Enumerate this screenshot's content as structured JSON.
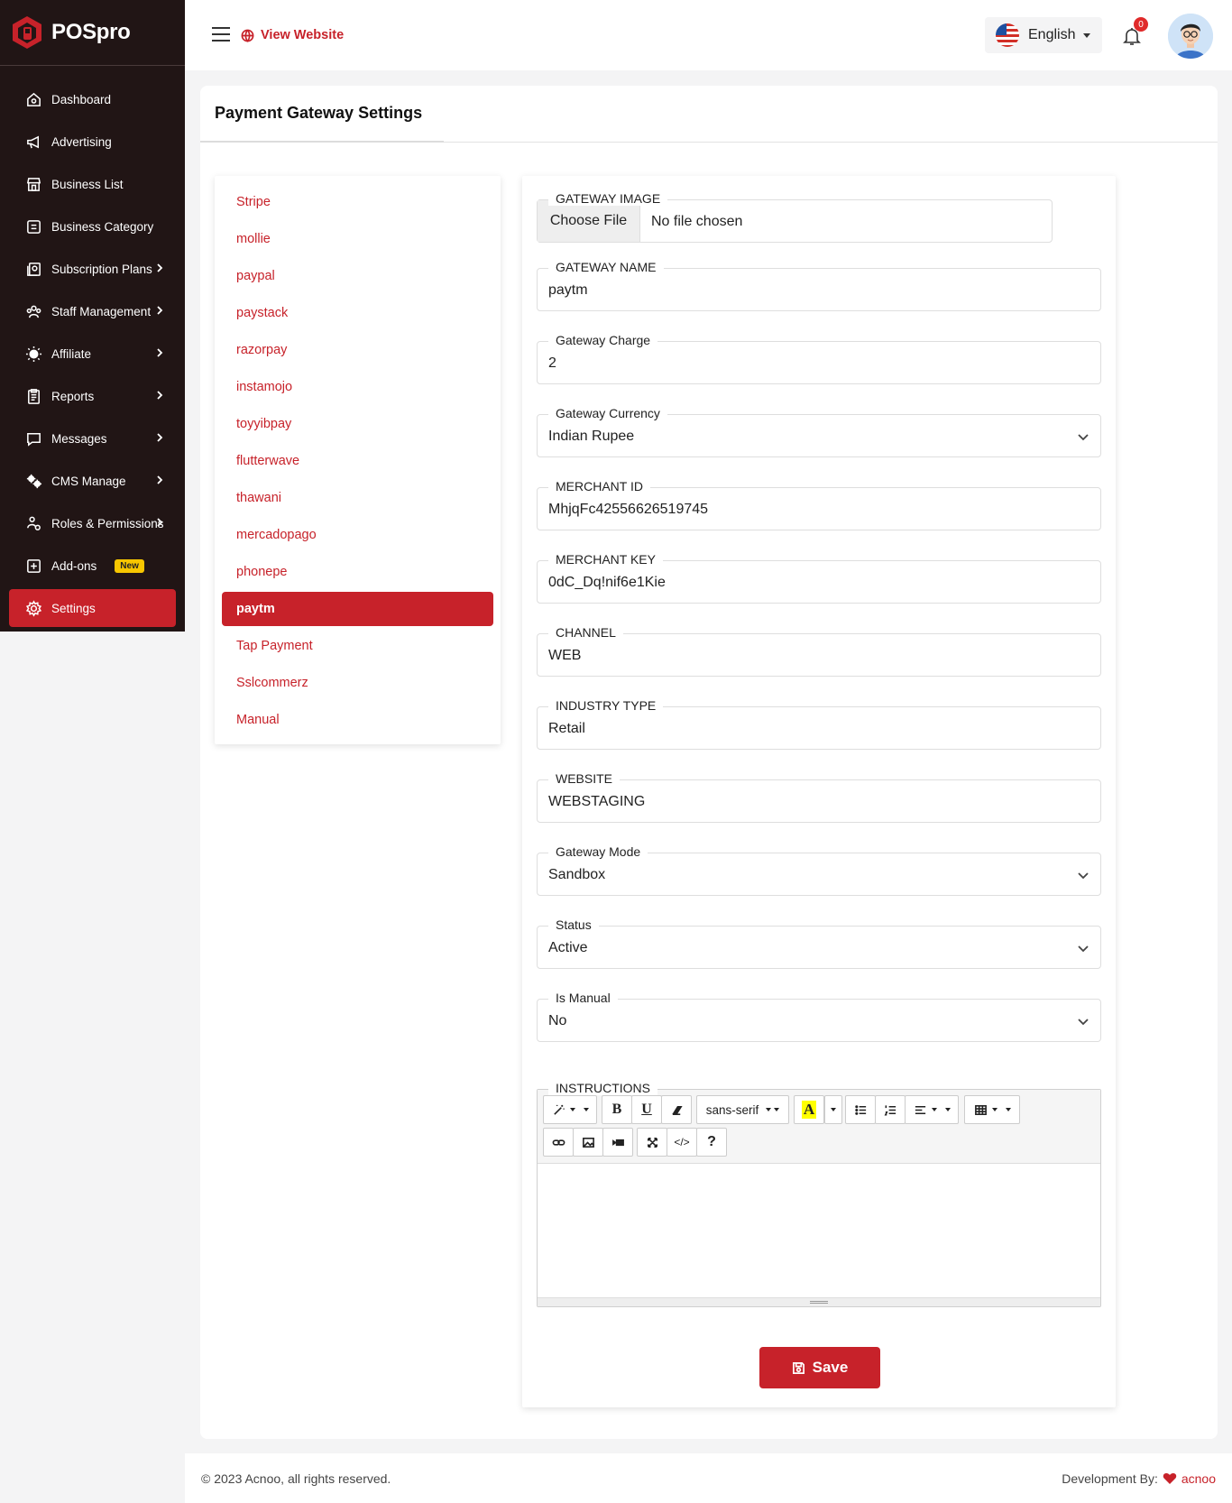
{
  "brand": {
    "name": "POSpro"
  },
  "sidebar": {
    "items": [
      {
        "label": "Dashboard",
        "icon": "home-icon",
        "chevron": false
      },
      {
        "label": "Advertising",
        "icon": "megaphone-icon",
        "chevron": false
      },
      {
        "label": "Business List",
        "icon": "store-icon",
        "chevron": false
      },
      {
        "label": "Business Category",
        "icon": "category-icon",
        "chevron": false
      },
      {
        "label": "Subscription Plans",
        "icon": "subscription-icon",
        "chevron": true
      },
      {
        "label": "Staff Management",
        "icon": "staff-icon",
        "chevron": true
      },
      {
        "label": "Affiliate",
        "icon": "affiliate-icon",
        "chevron": true
      },
      {
        "label": "Reports",
        "icon": "report-icon",
        "chevron": true
      },
      {
        "label": "Messages",
        "icon": "message-icon",
        "chevron": true
      },
      {
        "label": "CMS Manage",
        "icon": "cms-icon",
        "chevron": true
      },
      {
        "label": "Roles & Permissions",
        "icon": "roles-icon",
        "chevron": true
      },
      {
        "label": "Add-ons",
        "icon": "addon-icon",
        "chevron": false,
        "badge": "New"
      },
      {
        "label": "Settings",
        "icon": "gear-icon",
        "chevron": false,
        "active": true
      }
    ]
  },
  "header": {
    "view_website": "View Website",
    "language": "English",
    "notification_count": "0"
  },
  "page": {
    "title": "Payment Gateway Settings"
  },
  "gateways": [
    "Stripe",
    "mollie",
    "paypal",
    "paystack",
    "razorpay",
    "instamojo",
    "toyyibpay",
    "flutterwave",
    "thawani",
    "mercadopago",
    "phonepe",
    "paytm",
    "Tap Payment",
    "Sslcommerz",
    "Manual"
  ],
  "active_gateway": "paytm",
  "form": {
    "gateway_image": {
      "label": "GATEWAY IMAGE",
      "button": "Choose File",
      "status": "No file chosen"
    },
    "gateway_name": {
      "label": "GATEWAY NAME",
      "value": "paytm"
    },
    "gateway_charge": {
      "label": "Gateway Charge",
      "value": "2"
    },
    "gateway_currency": {
      "label": "Gateway Currency",
      "value": "Indian Rupee"
    },
    "merchant_id": {
      "label": "MERCHANT ID",
      "value": "MhjqFc42556626519745"
    },
    "merchant_key": {
      "label": "MERCHANT KEY",
      "value": "0dC_Dq!nif6e1Kie"
    },
    "channel": {
      "label": "CHANNEL",
      "value": "WEB"
    },
    "industry_type": {
      "label": "INDUSTRY TYPE",
      "value": "Retail"
    },
    "website": {
      "label": "WEBSITE",
      "value": "WEBSTAGING"
    },
    "gateway_mode": {
      "label": "Gateway Mode",
      "value": "Sandbox"
    },
    "status": {
      "label": "Status",
      "value": "Active"
    },
    "is_manual": {
      "label": "Is Manual",
      "value": "No"
    },
    "instructions": {
      "label": "INSTRUCTIONS",
      "font": "sans-serif"
    },
    "save": "Save"
  },
  "footer": {
    "copyright": "© 2023 Acnoo, all rights reserved.",
    "dev_prefix": "Development By:",
    "dev_name": "acnoo"
  },
  "colors": {
    "accent": "#c7222a",
    "sidebar": "#211515"
  }
}
